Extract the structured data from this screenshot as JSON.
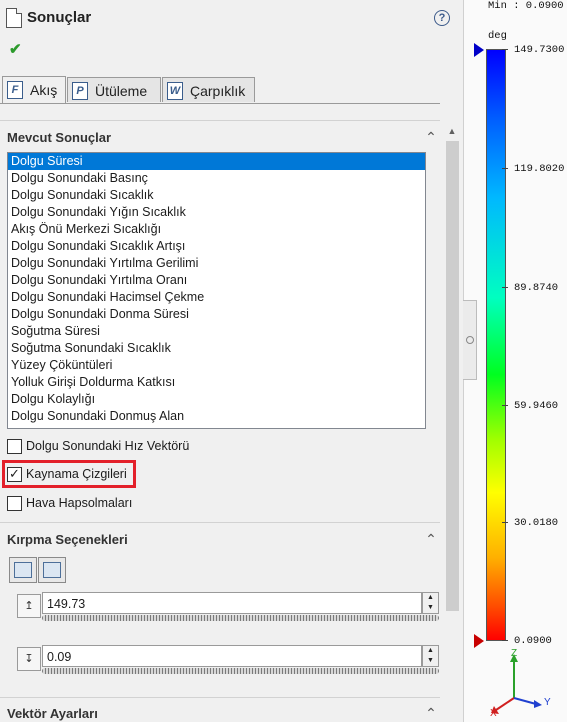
{
  "header": {
    "title": "Sonuçlar",
    "help": "?",
    "ok": "✔"
  },
  "tabs": [
    {
      "label": "Akış",
      "icon": "F"
    },
    {
      "label": "Ütüleme",
      "icon": "P"
    },
    {
      "label": "Çarpıklık",
      "icon": "W"
    }
  ],
  "results_section": {
    "title": "Mevcut Sonuçlar",
    "items": [
      "Dolgu Süresi",
      "Dolgu Sonundaki Basınç",
      "Dolgu Sonundaki Sıcaklık",
      "Dolgu Sonundaki Yığın Sıcaklık",
      "Akış Önü Merkezi Sıcaklığı",
      "Dolgu Sonundaki Sıcaklık Artışı",
      "Dolgu Sonundaki Yırtılma Gerilimi",
      "Dolgu Sonundaki Yırtılma Oranı",
      "Dolgu Sonundaki Hacimsel Çekme",
      "Dolgu Sonundaki Donma Süresi",
      "Soğutma Süresi",
      "Soğutma Sonundaki Sıcaklık",
      "Yüzey Çöküntüleri",
      "Yolluk Girişi Doldurma Katkısı",
      "Dolgu Kolaylığı",
      "Dolgu Sonundaki Donmuş Alan"
    ],
    "checkboxes": [
      {
        "label": "Dolgu Sonundaki Hız Vektörü",
        "checked": false
      },
      {
        "label": "Kaynama Çizgileri",
        "checked": true
      },
      {
        "label": "Hava Hapsolmaları",
        "checked": false
      }
    ]
  },
  "clip_section": {
    "title": "Kırpma Seçenekleri",
    "max_value": "149.73",
    "min_value": "0.09"
  },
  "vector_section": {
    "title": "Vektör Ayarları"
  },
  "legend": {
    "min_label": "Min : 0.0900",
    "unit": "deg",
    "values": [
      "149.7300",
      "119.8020",
      "89.8740",
      "59.9460",
      "30.0180",
      "0.0900"
    ],
    "axes": {
      "z": "Z",
      "x": "X",
      "y": "Y"
    }
  }
}
